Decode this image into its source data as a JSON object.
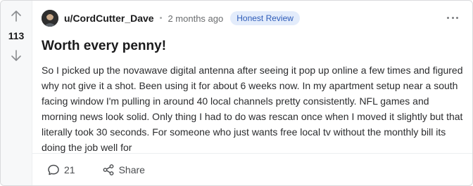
{
  "post": {
    "vote_count": "113",
    "username": "u/CordCutter_Dave",
    "separator": "•",
    "time": "2 months ago",
    "flair": "Honest Review",
    "title": "Worth every penny!",
    "body": "So I picked up the novawave digital antenna after seeing it pop up online a few times and figured why not give it a shot. Been using it for about 6 weeks now. In my apartment setup near a south facing window I'm pulling in around 40 local channels pretty consistently. NFL games and morning news look solid. Only thing I had to do was rescan once when I moved it slightly but that literally took 30 seconds. For someone who just wants free local tv without the monthly bill its doing the job well for"
  },
  "footer": {
    "comments_count": "21",
    "share_label": "Share"
  },
  "icons": {
    "upvote": "arrow-up-icon",
    "downvote": "arrow-down-icon",
    "comment": "comment-bubble-icon",
    "share": "share-nodes-icon",
    "more": "more-horizontal-icon"
  },
  "colors": {
    "flair_bg": "#e3ecfb",
    "flair_text": "#2d5bb8",
    "vote_column_bg": "#f7f8f9"
  }
}
